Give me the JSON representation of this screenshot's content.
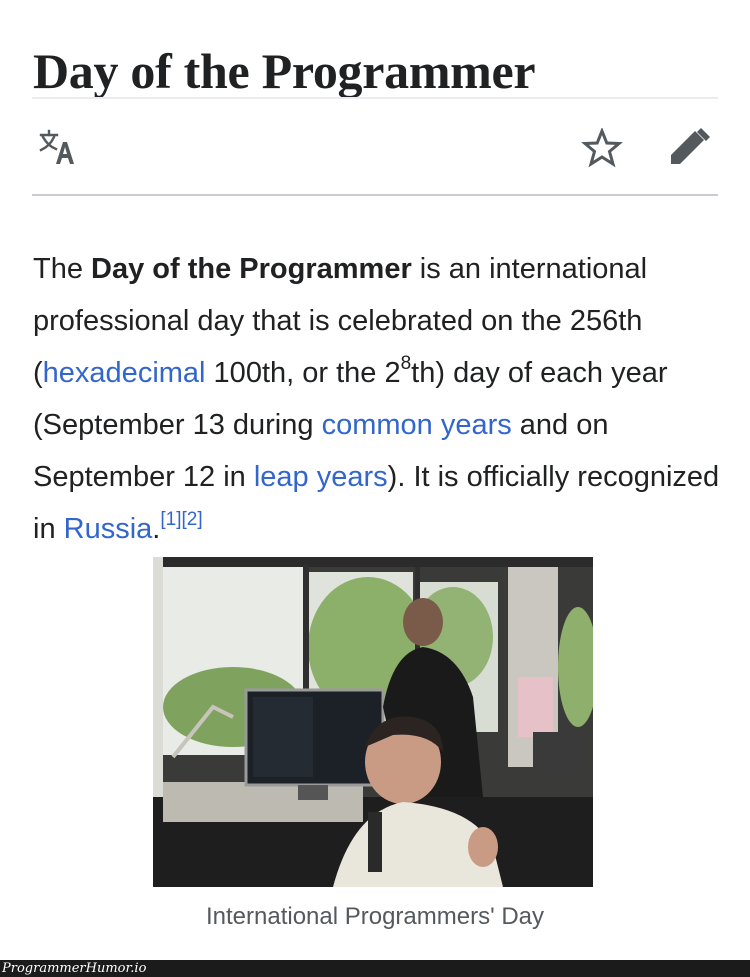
{
  "page": {
    "title": "Day of the Programmer"
  },
  "toolbar": {
    "language_icon": "translate-icon",
    "watch_icon": "star-icon",
    "edit_icon": "pencil-icon"
  },
  "lead": {
    "t1": "The ",
    "bold": "Day of the Programmer",
    "t2": " is an international professional day that is celebrated on the 256th (",
    "link_hexadecimal": "hexadecimal",
    "t3": " 100th, or the 2",
    "sup_exp": "8",
    "t4": "th) day of each year (September 13 during ",
    "link_common_years": "common years",
    "t5": " and on September 12 in ",
    "link_leap_years": "leap years",
    "t6": "). It is officially recognized in ",
    "link_russia": "Russia",
    "t7": ".",
    "ref1": "[1]",
    "ref2": "[2]"
  },
  "figure": {
    "caption": "International Programmers' Day"
  },
  "footer": {
    "watermark": "ProgrammerHumor.io"
  },
  "colors": {
    "link": "#3366cc",
    "text": "#202122",
    "icon": "#54595d"
  }
}
